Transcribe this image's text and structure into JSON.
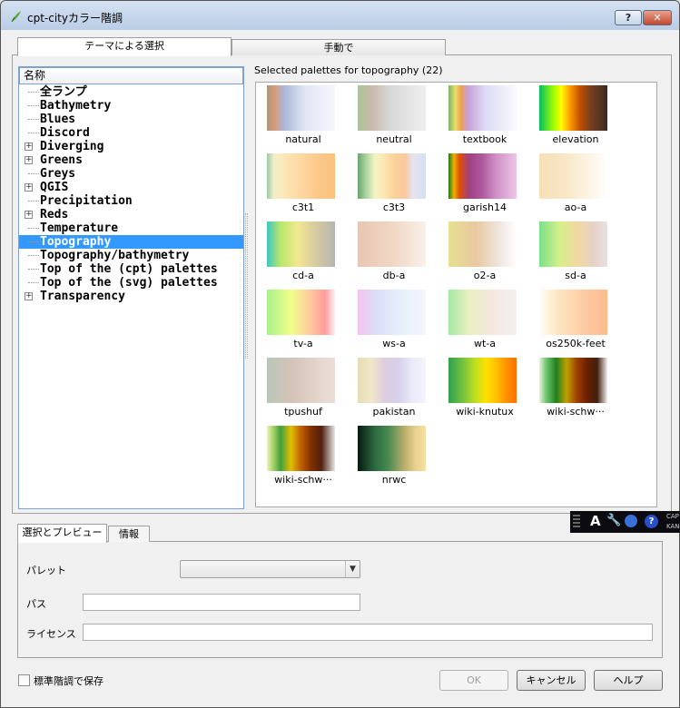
{
  "window": {
    "title": "cpt-cityカラー階調",
    "help_btn": "?",
    "close_btn": "✕"
  },
  "tabs": [
    "テーマによる選択",
    "手動で"
  ],
  "tree": {
    "header": "名称",
    "items": [
      {
        "label": "全ランプ",
        "expandable": false,
        "selected": false
      },
      {
        "label": "Bathymetry",
        "expandable": false,
        "selected": false
      },
      {
        "label": "Blues",
        "expandable": false,
        "selected": false
      },
      {
        "label": "Discord",
        "expandable": false,
        "selected": false
      },
      {
        "label": "Diverging",
        "expandable": true,
        "selected": false
      },
      {
        "label": "Greens",
        "expandable": true,
        "selected": false
      },
      {
        "label": "Greys",
        "expandable": false,
        "selected": false
      },
      {
        "label": "QGIS",
        "expandable": true,
        "selected": false
      },
      {
        "label": "Precipitation",
        "expandable": false,
        "selected": false
      },
      {
        "label": "Reds",
        "expandable": true,
        "selected": false
      },
      {
        "label": "Temperature",
        "expandable": false,
        "selected": false
      },
      {
        "label": "Topography",
        "expandable": false,
        "selected": true
      },
      {
        "label": "Topography/bathymetry",
        "expandable": false,
        "selected": false
      },
      {
        "label": "Top of the (cpt) palettes",
        "expandable": false,
        "selected": false
      },
      {
        "label": "Top of the (svg) palettes",
        "expandable": false,
        "selected": false
      },
      {
        "label": "Transparency",
        "expandable": true,
        "selected": false
      }
    ]
  },
  "palettes_caption": "Selected palettes for topography (22)",
  "palettes": [
    {
      "name": "natural",
      "gradient": "linear-gradient(90deg,#b0957e 0%,#d89a78 12%,#a8b8d8 25%,#e0e4f4 55%,#f6f6fc 100%)"
    },
    {
      "name": "neutral",
      "gradient": "linear-gradient(90deg,#a9c49a 0%,#c8b8a8 20%,#d6d6d6 45%,#efefef 100%)"
    },
    {
      "name": "textbook",
      "gradient": "linear-gradient(90deg,#7fb26a 0%,#e7e06a 10%,#f2a04a 18%,#c8a0d6 28%,#dcdcf6 55%,#fafafe 100%)"
    },
    {
      "name": "elevation",
      "gradient": "linear-gradient(90deg,#00c060 0%,#a6ff00 22%,#ffff00 32%,#ff9a00 45%,#c05000 60%,#7a4020 75%,#3a2a20 100%)"
    },
    {
      "name": "c3t1",
      "gradient": "linear-gradient(90deg,#9cc8a8 0%,#f2f0c8 10%,#fce8b8 25%,#fedaa6 45%,#fdcb8e 70%,#fbc17c 100%)"
    },
    {
      "name": "c3t3",
      "gradient": "linear-gradient(90deg,#6aa66a 0%,#a8d4a0 12%,#f5f3c4 25%,#fde4b0 40%,#fdd09a 55%,#f9c89e 70%,#e6e2ee 80%,#d4e0f0 100%)"
    },
    {
      "name": "garish14",
      "gradient": "linear-gradient(90deg,#1a7a1a 0%,#f0b000 8%,#e05000 16%,#a04080 30%,#b05aa0 50%,#d090c8 70%,#eec6e6 100%)"
    },
    {
      "name": "ao-a",
      "gradient": "linear-gradient(90deg,#f5dfb6 0%,#f8e8c8 40%,#fdf6ea 80%,#ffffff 100%)"
    },
    {
      "name": "cd-a",
      "gradient": "linear-gradient(90deg,#3ec6c0 0%,#b8e86a 20%,#f2e890 45%,#d8cca0 70%,#b8b4b0 100%)"
    },
    {
      "name": "db-a",
      "gradient": "linear-gradient(90deg,#e8c7b2 0%,#f0d6c4 50%,#fbf0ea 100%)"
    },
    {
      "name": "o2-a",
      "gradient": "linear-gradient(90deg,#e6e090 0%,#e8c8a0 40%,#f0e6e0 75%,#ffffff 100%)"
    },
    {
      "name": "sd-a",
      "gradient": "linear-gradient(90deg,#7ae08a 0%,#d6f08a 30%,#f2d8a0 55%,#e6d2c8 80%,#e8e0e4 100%)"
    },
    {
      "name": "tv-a",
      "gradient": "linear-gradient(90deg,#a8f08a 0%,#f0ff8a 35%,#ffd0a0 60%,#ff9a9a 85%,#fff0f0 100%)"
    },
    {
      "name": "ws-a",
      "gradient": "linear-gradient(90deg,#f6c2f0 0%,#dcdcf6 25%,#e4eefa 60%,#f4f6fc 100%)"
    },
    {
      "name": "wt-a",
      "gradient": "linear-gradient(90deg,#a4e8a4 0%,#e8f0c0 30%,#f4e6dc 60%,#f2f2f2 100%)"
    },
    {
      "name": "os250k-feet",
      "gradient": "linear-gradient(90deg,#fefefe 0%,#fdf4dc 12%,#fde4c0 30%,#fed6b0 50%,#fec8a0 70%,#febb90 100%)"
    },
    {
      "name": "tpushuf",
      "gradient": "linear-gradient(90deg,#b8c6b8 0%,#d6c4b8 40%,#e6d8d0 80%,#ecdcd8 100%)"
    },
    {
      "name": "pakistan",
      "gradient": "linear-gradient(90deg,#e6dcb6 0%,#f0e8c8 20%,#ddcce0 40%,#d6d0ec 60%,#eaeaf8 80%,#f4f4fc 100%)"
    },
    {
      "name": "wiki-knutux",
      "gradient": "linear-gradient(90deg,#30a050 0%,#70c040 20%,#c0e020 40%,#ffe000 55%,#ffc000 70%,#ff9000 85%,#ff7000 100%)"
    },
    {
      "name": "wiki-schw···",
      "gradient": "linear-gradient(90deg,#f0f0e0 0%,#70c870 10%,#208020 25%,#c0a000 40%,#a04000 55%,#6a2000 70%,#402010 85%,#f0f0f0 100%)"
    },
    {
      "name": "wiki-schw···",
      "gradient": "linear-gradient(90deg,#f0f0c0 0%,#a0d060 10%,#40a040 20%,#e0c000 35%,#c06000 50%,#803000 65%,#502010 80%,#e8e8e8 100%)"
    },
    {
      "name": "nrwc",
      "gradient": "linear-gradient(90deg,#081a10 0%,#2a6a40 25%,#4a8a50 45%,#c0b070 70%,#e8d090 85%,#f4e0a0 100%)"
    }
  ],
  "taskbar": {
    "a": "A",
    "tool": "🔧",
    "help": "?",
    "cap": "CAP",
    "kan": "KAN"
  },
  "bottom_tabs": [
    "選択とプレビュー",
    "情報"
  ],
  "fields": {
    "palette_label": "パレット",
    "palette_value": "",
    "path_label": "パス",
    "path_value": "",
    "license_label": "ライセンス",
    "license_value": ""
  },
  "save_checkbox_label": "標準階調で保存",
  "buttons": {
    "ok": "OK",
    "cancel": "キャンセル",
    "help": "ヘルプ"
  }
}
